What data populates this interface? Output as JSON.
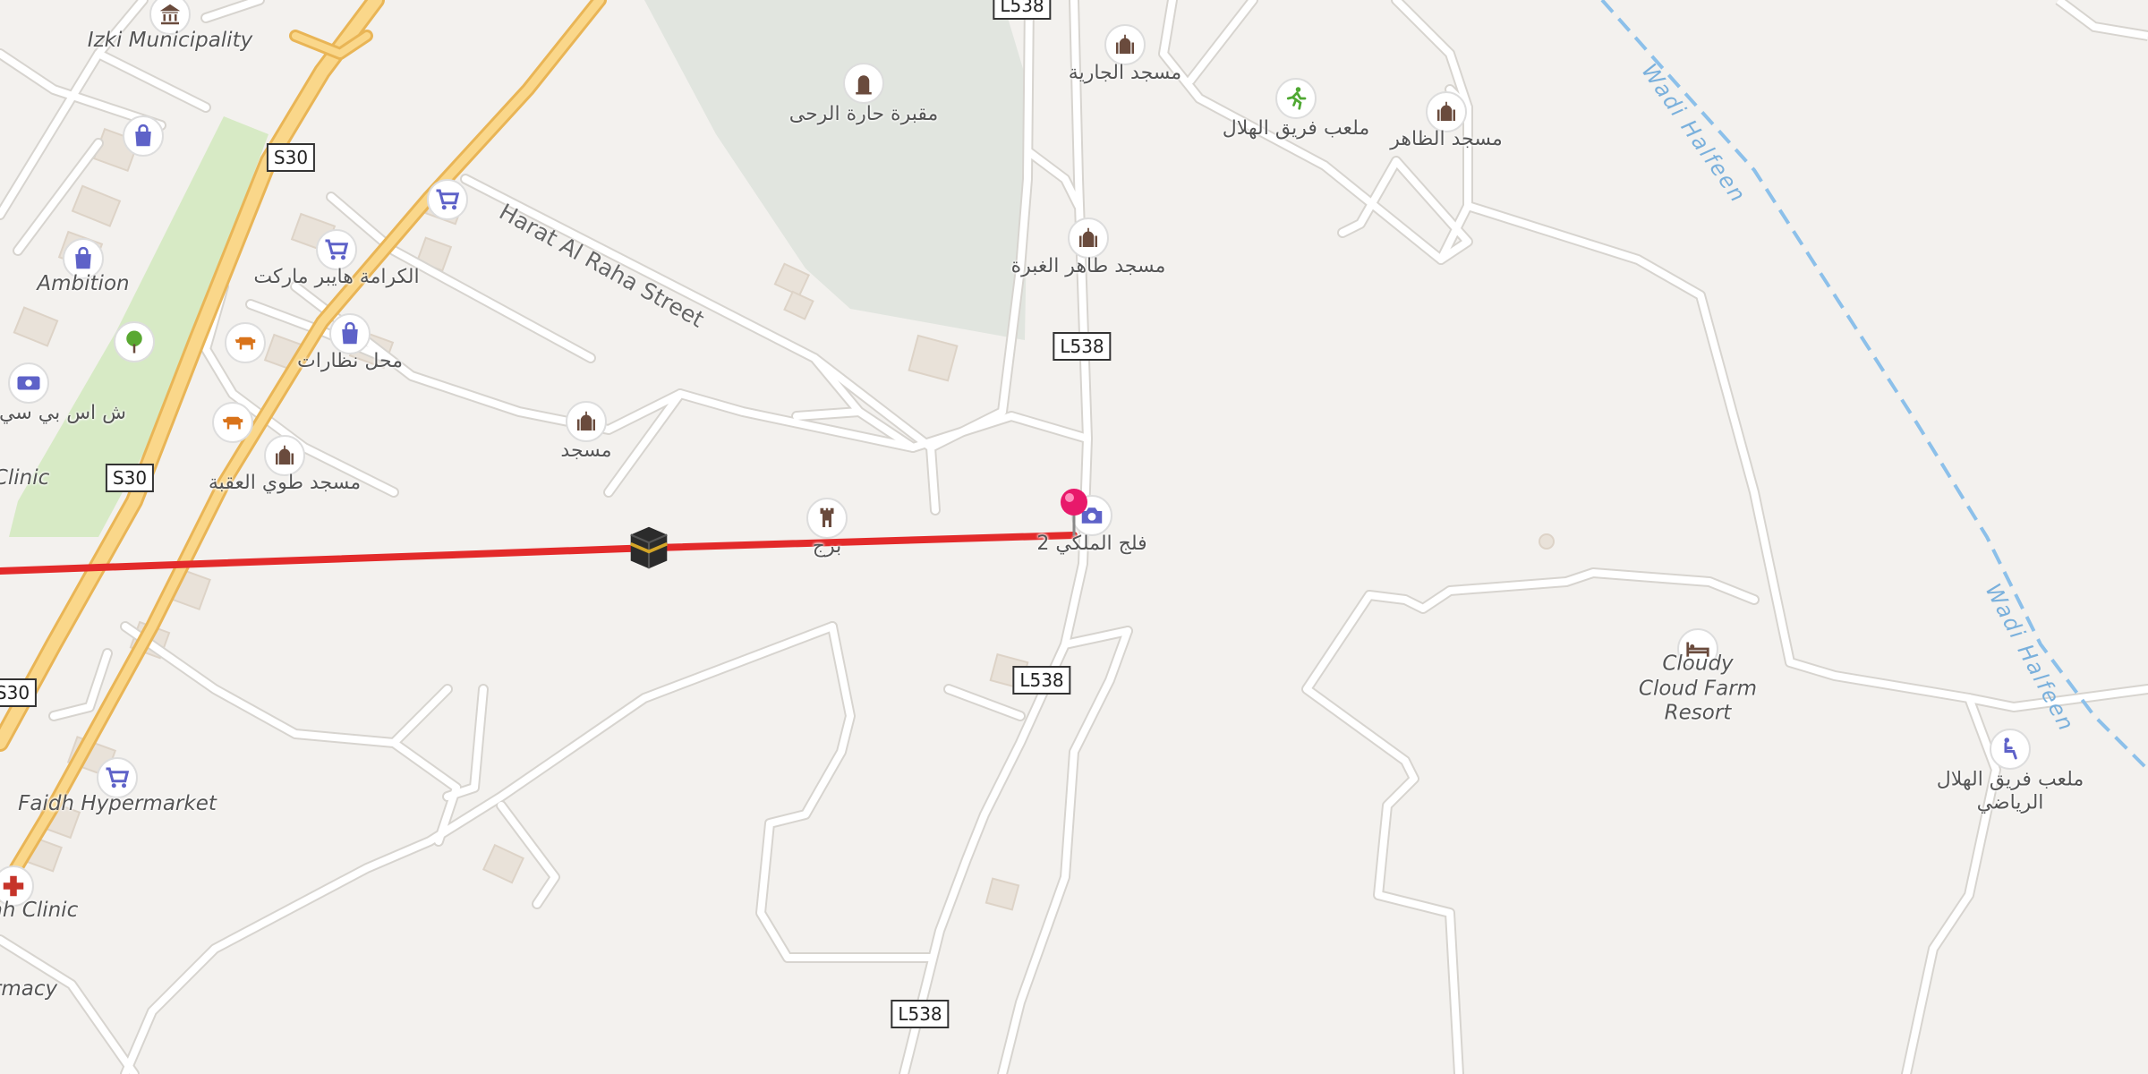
{
  "map": {
    "colors": {
      "background": "#f3f1ee",
      "road": "#ffffff",
      "road_casing": "#d7d4cf",
      "motorway": "#fad78a",
      "motorway_casing": "#e9b556",
      "park": "#d7eac5",
      "cemetery": "#e1e5df",
      "building": "#e9e2d9",
      "route_line": "#e32a2a",
      "waterway": "#8cc0ea",
      "marker": "#e8196b"
    },
    "road_shields": {
      "s30_a": "S30",
      "s30_b": "S30",
      "s30_c": "S30",
      "l538_a": "L538",
      "l538_b": "L538",
      "l538_c": "L538",
      "l538_d": "L538"
    },
    "street_names": {
      "harat_al_raha": "Harat Al Raha Street"
    },
    "waterway_names": {
      "wadi_upper": "Wadi Halfeen",
      "wadi_lower": "Wadi Halfeen"
    },
    "labels": {
      "izki_municipality": "Izki Municipality",
      "ambition": "Ambition",
      "clinic_left": "Clinic",
      "sps_bank": "ش اس بي سي",
      "faidh_hypermarket": "Faidh Hypermarket",
      "clinic_lower": "ah Clinic",
      "pharmacy": "rmacy",
      "cemetery_name": "مقبرة حارة الرحى",
      "al_karama_market": "الكرامة هايبر ماركت",
      "optics_shop": "محل نظارات",
      "mosque": "مسجد",
      "mosque_tawi_aqaba": "مسجد طوي العقبة",
      "tower": "برج",
      "falaj_al_malki": "فلج الملكي 2",
      "mosque_al_jariya": "مسجد الجارية",
      "mosque_tahir_ghabra": "مسجد طاهر الغبرة",
      "hilal_team_field": "ملعب فريق الهلال",
      "mosque_al_zahir": "مسجد الظاهر",
      "cloudy_cloud_resort": "Cloudy Cloud Farm Resort",
      "hilal_sports_field": "ملعب فريق الهلال الرياضي"
    },
    "icons": {
      "townhall": "townhall-icon",
      "shop_bag": "shopping-bag-icon",
      "cart": "shopping-cart-icon",
      "bank": "banknote-icon",
      "tree": "tree-icon",
      "butcher": "cow-icon",
      "mosque": "mosque-icon",
      "grave": "grave-icon",
      "tower": "tower-icon",
      "camera": "camera-icon",
      "sport": "running-icon",
      "hotel": "bed-icon",
      "stadium": "sports-centre-icon",
      "hospital": "hospital-cross-icon",
      "kaaba": "kaaba-icon",
      "pin": "location-pin-icon"
    }
  }
}
